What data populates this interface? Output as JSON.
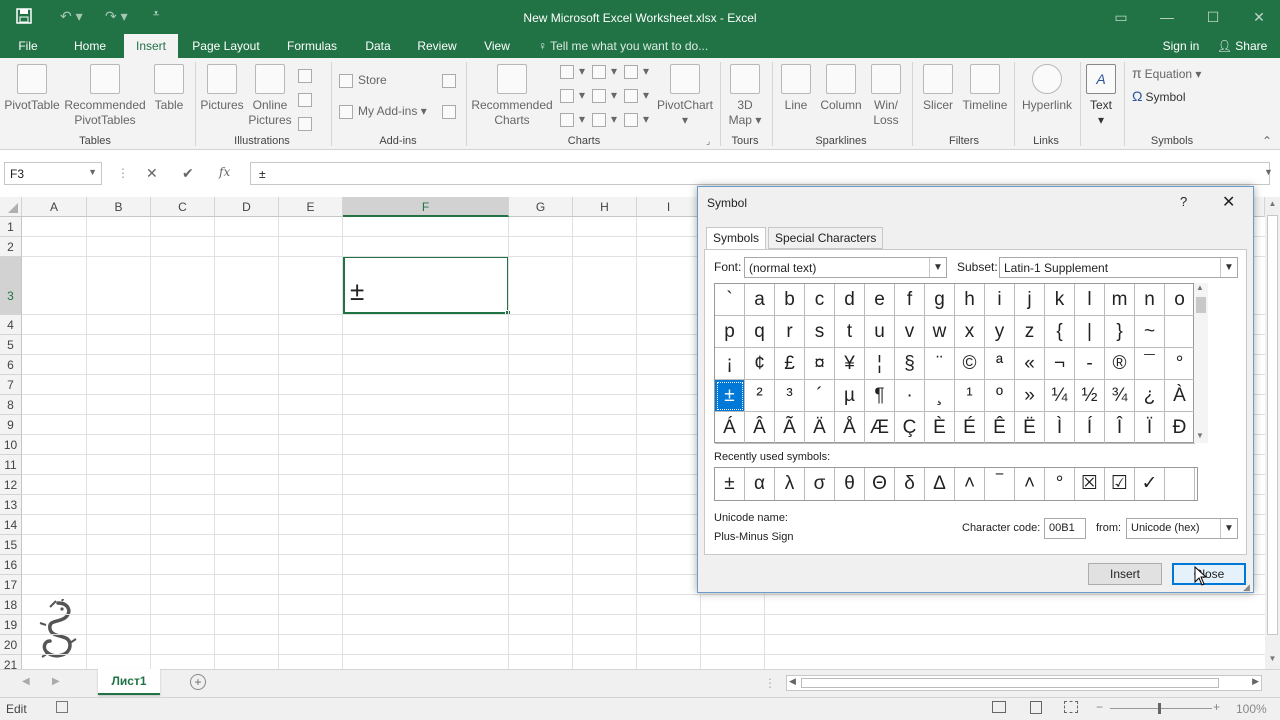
{
  "window": {
    "title": "New Microsoft Excel Worksheet.xlsx - Excel",
    "colors": {
      "brand": "#217346",
      "select": "#0078d7"
    }
  },
  "menu": {
    "tabs": [
      {
        "label": "File"
      },
      {
        "label": "Home"
      },
      {
        "label": "Insert"
      },
      {
        "label": "Page Layout"
      },
      {
        "label": "Formulas"
      },
      {
        "label": "Data"
      },
      {
        "label": "Review"
      },
      {
        "label": "View"
      }
    ],
    "active_tab": "Insert",
    "tell_me": "Tell me what you want to do...",
    "sign_in": "Sign in",
    "share": "Share"
  },
  "ribbon": {
    "tables": {
      "label": "Tables",
      "pivottable": "PivotTable",
      "rec_pivot_1": "Recommended",
      "rec_pivot_2": "PivotTables",
      "table": "Table"
    },
    "illustrations": {
      "label": "Illustrations",
      "pictures": "Pictures",
      "online_1": "Online",
      "online_2": "Pictures"
    },
    "addins": {
      "label": "Add-ins",
      "store": "Store",
      "my_addins": "My Add-ins"
    },
    "charts": {
      "label": "Charts",
      "rec_1": "Recommended",
      "rec_2": "Charts",
      "pivotchart": "PivotChart"
    },
    "tours": {
      "label": "Tours",
      "map_1": "3D",
      "map_2": "Map"
    },
    "sparklines": {
      "label": "Sparklines",
      "line": "Line",
      "column": "Column",
      "winloss_1": "Win/",
      "winloss_2": "Loss"
    },
    "filters": {
      "label": "Filters",
      "slicer": "Slicer",
      "timeline": "Timeline"
    },
    "links": {
      "label": "Links",
      "hyperlink": "Hyperlink"
    },
    "text": {
      "label": "Text"
    },
    "symbols": {
      "label": "Symbols",
      "equation": "Equation",
      "symbol": "Symbol"
    }
  },
  "formula_bar": {
    "name_box": "F3",
    "value": "±"
  },
  "grid": {
    "columns": [
      "A",
      "B",
      "C",
      "D",
      "E",
      "F",
      "G",
      "H",
      "I"
    ],
    "selected_column": "F",
    "rows": [
      "1",
      "2",
      "3",
      "4",
      "5",
      "6",
      "7",
      "8",
      "9",
      "10",
      "11",
      "12",
      "13",
      "14",
      "15",
      "16",
      "17",
      "18",
      "19",
      "20",
      "21"
    ],
    "selected_row": "3",
    "active_cell": "F3",
    "active_cell_value": "±"
  },
  "sheet_tabs": {
    "active": "Лист1"
  },
  "status": {
    "mode": "Edit",
    "zoom": "100%"
  },
  "dialog": {
    "title": "Symbol",
    "help": "?",
    "tabs": [
      "Symbols",
      "Special Characters"
    ],
    "active_tab": "Symbols",
    "font_label": "Font:",
    "font_value": "(normal text)",
    "subset_label": "Subset:",
    "subset_value": "Latin-1 Supplement",
    "symbols": [
      [
        "`",
        "a",
        "b",
        "c",
        "d",
        "e",
        "f",
        "g",
        "h",
        "i",
        "j",
        "k",
        "l",
        "m",
        "n",
        "o"
      ],
      [
        "p",
        "q",
        "r",
        "s",
        "t",
        "u",
        "v",
        "w",
        "x",
        "y",
        "z",
        "{",
        "|",
        "}",
        "~",
        ""
      ],
      [
        "¡",
        "¢",
        "£",
        "¤",
        "¥",
        "¦",
        "§",
        "¨",
        "©",
        "ª",
        "«",
        "¬",
        "-",
        "®",
        "¯",
        "°"
      ],
      [
        "±",
        "²",
        "³",
        "´",
        "µ",
        "¶",
        "·",
        "¸",
        "¹",
        "º",
        "»",
        "¼",
        "½",
        "¾",
        "¿",
        "À"
      ],
      [
        "Á",
        "Â",
        "Ã",
        "Ä",
        "Å",
        "Æ",
        "Ç",
        "È",
        "É",
        "Ê",
        "Ë",
        "Ì",
        "Í",
        "Î",
        "Ï",
        "Ð"
      ]
    ],
    "selected_symbol": "±",
    "recent_label": "Recently used symbols:",
    "recent": [
      "±",
      "α",
      "λ",
      "σ",
      "θ",
      "Θ",
      "δ",
      "Δ",
      "˄",
      "‾",
      "˄",
      "°",
      "☒",
      "☑",
      "✓",
      ""
    ],
    "unicode_name_label": "Unicode name:",
    "unicode_name": "Plus-Minus Sign",
    "char_code_label": "Character code:",
    "char_code": "00B1",
    "from_label": "from:",
    "from_value": "Unicode (hex)",
    "insert_button": "Insert",
    "close_button": "Close"
  }
}
